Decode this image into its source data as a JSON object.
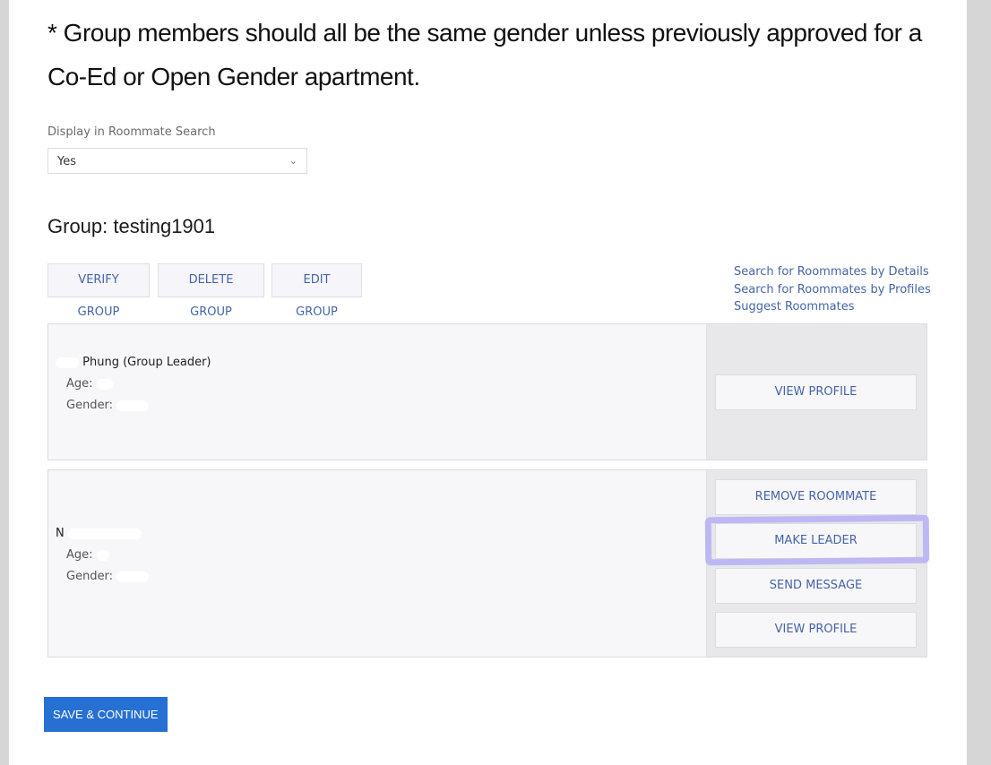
{
  "notice": "* Group members should all be the same gender unless previously approved for a Co-Ed or Open Gender apartment.",
  "roommate_search": {
    "label": "Display in Roommate Search",
    "value": "Yes",
    "chevron_icon": "chevron-down-icon"
  },
  "group": {
    "title": "Group: testing1901",
    "actions": {
      "verify": "VERIFY GROUP",
      "delete": "DELETE GROUP",
      "edit": "EDIT GROUP"
    },
    "links": [
      "Search for Roommates by Details",
      "Search for Roommates by Profiles",
      "Suggest Roommates"
    ]
  },
  "members": [
    {
      "name": "Phung (Group Leader)",
      "age_label": "Age:",
      "gender_label": "Gender:",
      "actions": [
        "VIEW PROFILE"
      ]
    },
    {
      "name": "N",
      "age_label": "Age:",
      "gender_label": "Gender:",
      "actions": [
        "REMOVE ROOMMATE",
        "MAKE LEADER",
        "SEND MESSAGE",
        "VIEW PROFILE"
      ]
    }
  ],
  "footer": {
    "save_label": "SAVE & CONTINUE"
  },
  "colors": {
    "accent_link": "#4565a8",
    "primary_button": "#2670d4",
    "highlight_annotation": "#b8b2f4"
  }
}
